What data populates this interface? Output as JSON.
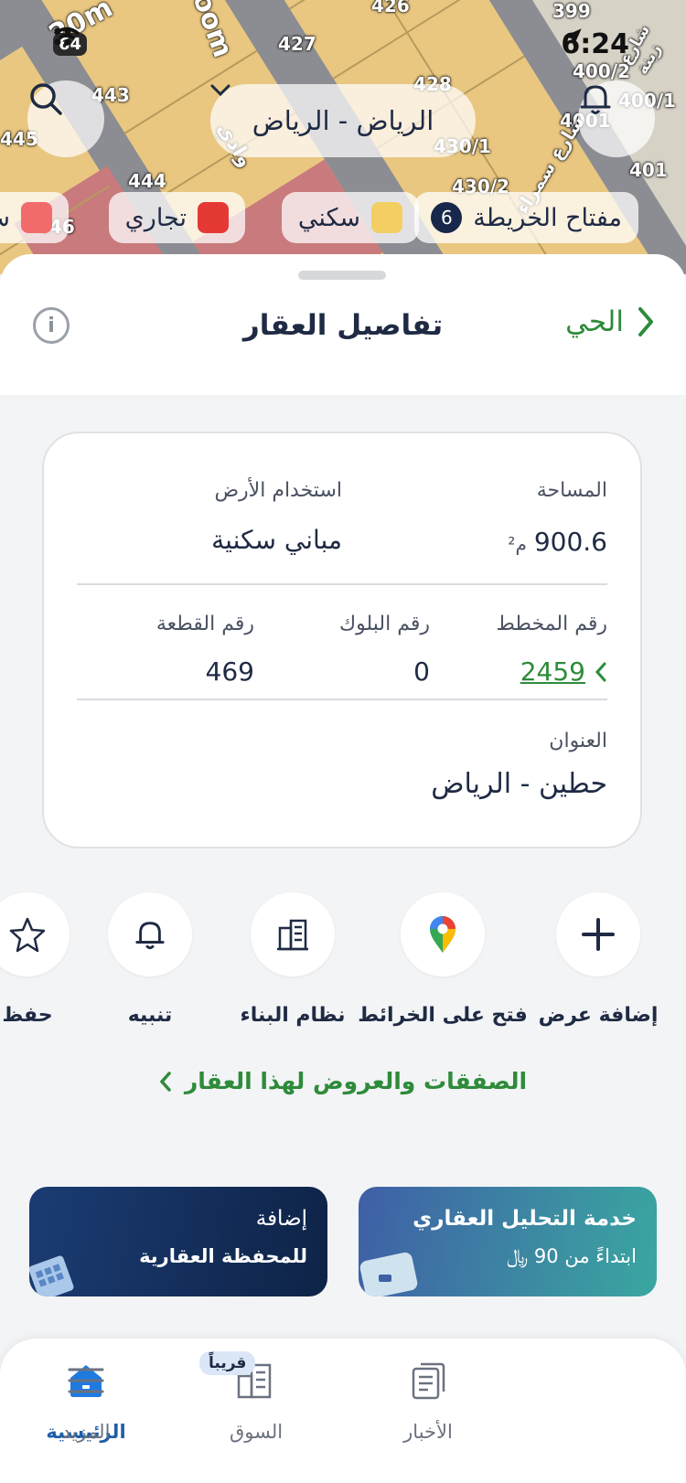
{
  "status": {
    "time": "6:24",
    "battery": "64"
  },
  "map": {
    "plot_numbers": [
      "443",
      "445",
      "444",
      "446",
      "427",
      "428",
      "426",
      "399",
      "400/2",
      "400/1",
      "4001",
      "430/1",
      "430/2",
      "401"
    ],
    "street_labels": [
      "20m",
      "oom",
      "وادي",
      "شارع سمراء",
      "شارع زينة"
    ],
    "city_label": "الرياض - الرياض",
    "legend": {
      "key_label": "مفتاح الخريطة",
      "key_count": "6",
      "items": [
        {
          "label": "سكني",
          "color": "#f3cf63"
        },
        {
          "label": "تجاري",
          "color": "#e53935"
        },
        {
          "label": "ش",
          "color": "#f26b6b"
        }
      ]
    },
    "colors": {
      "residential": "#e9c781",
      "commercial": "#c97a7d",
      "street": "#8b8d92"
    }
  },
  "sheet": {
    "title": "تفاصيل العقار",
    "back_label": "الحي",
    "info_icon": "i",
    "fields": {
      "area_label": "المساحة",
      "area_value": "900.6",
      "area_unit": "م²",
      "land_use_label": "استخدام الأرض",
      "land_use_value": "مباني سكنية",
      "plan_label": "رقم المخطط",
      "plan_value": "2459",
      "block_label": "رقم البلوك",
      "block_value": "0",
      "plot_label": "رقم القطعة",
      "plot_value": "469",
      "address_label": "العنوان",
      "address_value": "حطين - الرياض"
    },
    "actions": [
      {
        "label": "إضافة عرض",
        "icon": "plus-icon"
      },
      {
        "label": "فتح على الخرائط",
        "icon": "map-pin-icon"
      },
      {
        "label": "نظام البناء",
        "icon": "buildings-icon"
      },
      {
        "label": "تنبيه",
        "icon": "bell-icon"
      },
      {
        "label": "حفظ",
        "icon": "star-icon"
      }
    ],
    "deals_link": "الصفقات والعروض لهذا العقار",
    "promos": [
      {
        "line1": "خدمة التحليل العقاري",
        "line2": "ابتداءً من 90 ﷼"
      },
      {
        "line1": "إضافة",
        "line2": "للمحفظة العقارية"
      }
    ]
  },
  "nav": {
    "items": [
      {
        "label": "الرئيسية",
        "icon": "home-icon",
        "active": true
      },
      {
        "label": "السوق",
        "icon": "market-icon",
        "badge": "قريباً"
      },
      {
        "label": "الأخبار",
        "icon": "news-icon"
      },
      {
        "label": "المزيد",
        "icon": "menu-icon"
      }
    ]
  }
}
